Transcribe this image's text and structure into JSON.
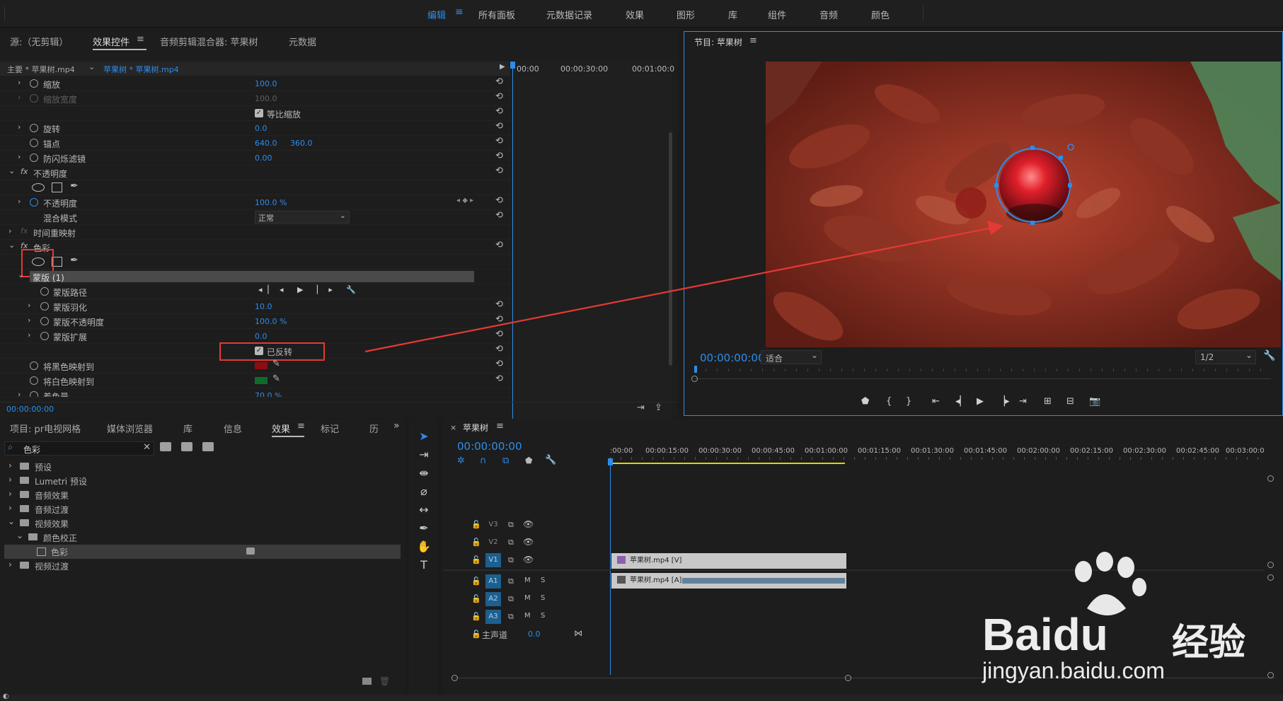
{
  "workspace_bar": {
    "items": [
      "编辑",
      "所有面板",
      "元数据记录",
      "效果",
      "图形",
      "库",
      "组件",
      "音频",
      "颜色"
    ],
    "active": "编辑"
  },
  "source_panel": {
    "tabs": [
      "源:（无剪辑）",
      "效果控件",
      "音频剪辑混合器: 苹果树",
      "元数据"
    ],
    "active_tab": "效果控件"
  },
  "effect_controls": {
    "master_clip": "主要 * 苹果树.mp4",
    "sequence_clip": "苹果树 * 苹果树.mp4",
    "ruler": [
      "00:00",
      "00:00:30:00",
      "00:01:00:0"
    ],
    "rows": [
      {
        "label": "缩放",
        "value": "100.0"
      },
      {
        "label": "缩放宽度",
        "value": "100.0"
      },
      {
        "label": "等比缩放",
        "value": ""
      },
      {
        "label": "旋转",
        "value": "0.0"
      },
      {
        "label": "锚点",
        "value": "640.0",
        "value2": "360.0"
      },
      {
        "label": "防闪烁滤镜",
        "value": "0.00"
      },
      {
        "label": "不透明度",
        "value": ""
      },
      {
        "label": "不透明度",
        "value": "100.0 %"
      },
      {
        "label": "混合模式",
        "value": "正常"
      },
      {
        "label": "时间重映射",
        "value": ""
      },
      {
        "label": "色彩",
        "value": ""
      },
      {
        "label": "蒙版 (1)",
        "value": ""
      },
      {
        "label": "蒙版路径",
        "value": ""
      },
      {
        "label": "蒙版羽化",
        "value": "10.0"
      },
      {
        "label": "蒙版不透明度",
        "value": "100.0 %"
      },
      {
        "label": "蒙版扩展",
        "value": "0.0"
      },
      {
        "label": "已反转",
        "value": ""
      },
      {
        "label": "将黑色映射到",
        "value": ""
      },
      {
        "label": "将白色映射到",
        "value": ""
      },
      {
        "label": "着色量",
        "value": "70.0 %"
      }
    ],
    "fx_label": "fx",
    "timecode": "00:00:00:00",
    "black_color": "#8b0f0f",
    "white_color": "#0f6b2a"
  },
  "program_monitor": {
    "title": "节目: 苹果树",
    "timecode": "00:00:00:00",
    "fit": "适合",
    "resolution": "1/2"
  },
  "project_panel": {
    "tabs": [
      "项目: pr电视网格",
      "媒体浏览器",
      "库",
      "信息",
      "效果",
      "标记",
      "历"
    ],
    "active_tab": "效果",
    "search_value": "色彩",
    "tree": [
      {
        "label": "预设",
        "depth": 0,
        "type": "folder"
      },
      {
        "label": "Lumetri 预设",
        "depth": 0,
        "type": "folder"
      },
      {
        "label": "音频效果",
        "depth": 0,
        "type": "folder"
      },
      {
        "label": "音频过渡",
        "depth": 0,
        "type": "folder"
      },
      {
        "label": "视频效果",
        "depth": 0,
        "type": "folder",
        "open": true
      },
      {
        "label": "颜色校正",
        "depth": 1,
        "type": "folder",
        "open": true
      },
      {
        "label": "色彩",
        "depth": 2,
        "type": "effect",
        "selected": true
      },
      {
        "label": "视频过渡",
        "depth": 0,
        "type": "folder"
      }
    ]
  },
  "timeline": {
    "sequence": "苹果树",
    "timecode": "00:00:00:00",
    "ruler": [
      ":00:00",
      "00:00:15:00",
      "00:00:30:00",
      "00:00:45:00",
      "00:01:00:00",
      "00:01:15:00",
      "00:01:30:00",
      "00:01:45:00",
      "00:02:00:00",
      "00:02:15:00",
      "00:02:30:00",
      "00:02:45:00",
      "00:03:00:0"
    ],
    "tracks": [
      "V3",
      "V2",
      "V1",
      "A1",
      "A2",
      "A3"
    ],
    "master": "主声道",
    "master_value": "0.0",
    "video_clip": "苹果树.mp4 [V]",
    "audio_clip": "苹果树.mp4 [A]",
    "m_label": "M",
    "s_label": "S"
  },
  "watermark": {
    "brand": "Baidu",
    "cn": "经验",
    "url": "jingyan.baidu.com"
  }
}
